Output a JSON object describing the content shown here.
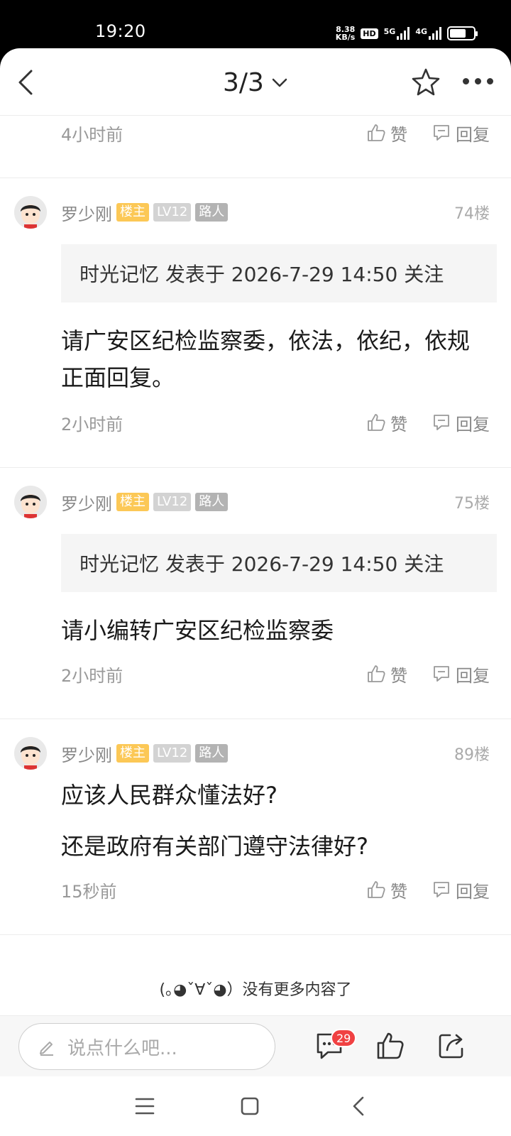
{
  "status_bar": {
    "time": "19:20",
    "speed_value": "8.38",
    "speed_unit": "KB/s",
    "hd_label": "HD",
    "net1": "5G",
    "net2": "4G",
    "battery_level": 0.7
  },
  "nav": {
    "page_indicator": "3/3"
  },
  "prev_comment": {
    "time": "4小时前",
    "like_label": "赞",
    "reply_label": "回复"
  },
  "comments": [
    {
      "author": "罗少刚",
      "badge_owner": "楼主",
      "badge_level": "LV12",
      "badge_role": "路人",
      "floor": "74楼",
      "quote": "时光记忆 发表于 2026-7-29 14:50 关注",
      "text": "请广安区纪检监察委，依法，依纪，依规正面回复。",
      "time": "2小时前",
      "like_label": "赞",
      "reply_label": "回复"
    },
    {
      "author": "罗少刚",
      "badge_owner": "楼主",
      "badge_level": "LV12",
      "badge_role": "路人",
      "floor": "75楼",
      "quote": "时光记忆 发表于 2026-7-29 14:50 关注",
      "text": "请小编转广安区纪检监察委",
      "time": "2小时前",
      "like_label": "赞",
      "reply_label": "回复"
    },
    {
      "author": "罗少刚",
      "badge_owner": "楼主",
      "badge_level": "LV12",
      "badge_role": "路人",
      "floor": "89楼",
      "line1": "应该人民群众懂法好?",
      "line2": "还是政府有关部门遵守法律好?",
      "time": "15秒前",
      "like_label": "赞",
      "reply_label": "回复"
    }
  ],
  "end_text": "(｡◕ˇ∀ˇ◕）没有更多内容了",
  "bottom_bar": {
    "input_placeholder": "说点什么吧...",
    "comment_count": "29"
  },
  "colors": {
    "badge_owner": "#fcc856",
    "badge_level": "#d3d3d3",
    "badge_role": "#b3b3b3",
    "unread": "#f04142"
  }
}
